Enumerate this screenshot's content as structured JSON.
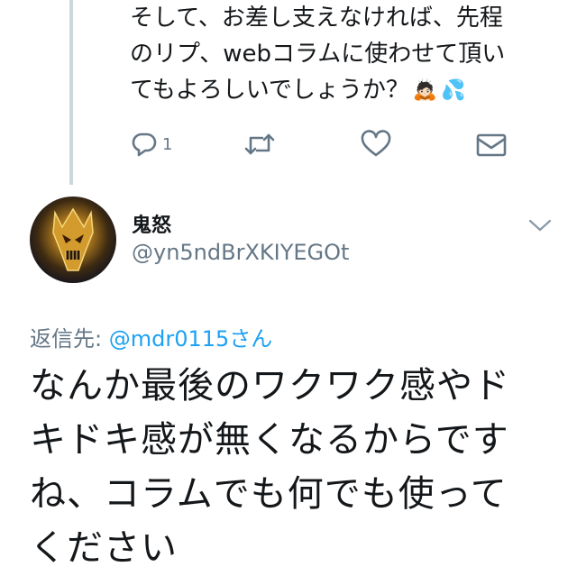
{
  "previous_tweet": {
    "lines": [
      "そして、お差し支えなければ、先程",
      "のリプ、webコラムに使わせて頂い",
      "てもよろしいでしょうか？"
    ],
    "emojis": [
      "🙇🏻",
      "💦"
    ],
    "reply_count": "1"
  },
  "tweet": {
    "display_name": "鬼怒",
    "handle": "@yn5ndBrXKIYEGOt",
    "reply_prefix": "返信先: ",
    "reply_mention": "@mdr0115さん",
    "lines": [
      "なんか最後のワクワク感やド",
      "キドキ感が無くなるからです",
      "ね、コラムでも何でも使って",
      "ください"
    ]
  },
  "colors": {
    "link": "#1da1f2",
    "secondary": "#657786",
    "thread_line": "#ccd6dd"
  },
  "icons": [
    "reply-icon",
    "retweet-icon",
    "like-icon",
    "dm-icon",
    "chevron-down-icon"
  ]
}
